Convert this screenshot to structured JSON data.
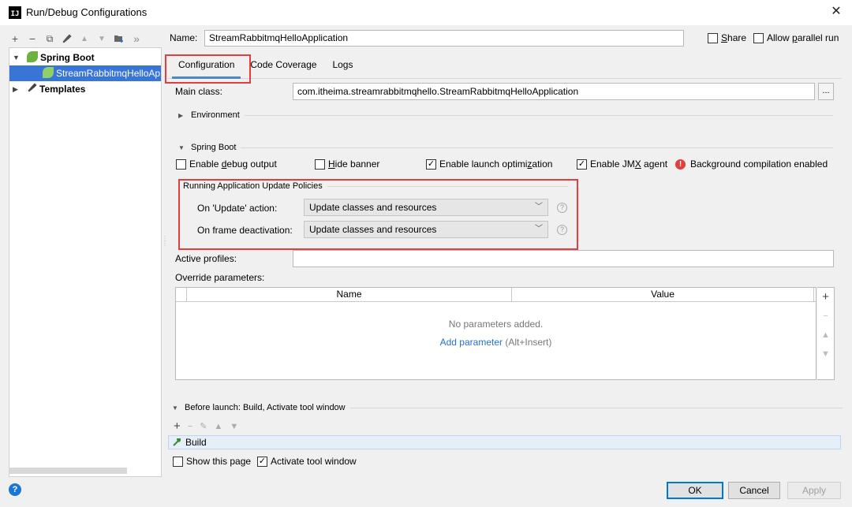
{
  "window": {
    "title": "Run/Debug Configurations",
    "app_icon_text": "IJ",
    "close_glyph": "✕"
  },
  "sidebar": {
    "toolbar": [
      {
        "icon": "plus-icon",
        "glyph": "+",
        "enabled": true
      },
      {
        "icon": "minus-icon",
        "glyph": "−",
        "enabled": true
      },
      {
        "icon": "copy-icon",
        "glyph": "⧉",
        "enabled": true
      },
      {
        "icon": "wrench-icon",
        "glyph": "🔧",
        "enabled": true
      },
      {
        "icon": "arrow-up-icon",
        "glyph": "▲",
        "enabled": false
      },
      {
        "icon": "arrow-down-icon",
        "glyph": "▼",
        "enabled": false
      },
      {
        "icon": "folder-icon",
        "glyph": "📁",
        "enabled": true
      },
      {
        "icon": "more-icon",
        "glyph": "»",
        "enabled": true
      }
    ],
    "tree": {
      "spring_boot": "Spring Boot",
      "selected_item": "StreamRabbitmqHelloAp",
      "templates": "Templates"
    }
  },
  "header": {
    "name_label": "Name:",
    "name_value": "StreamRabbitmqHelloApplication",
    "share_label": "Share",
    "share_checked": false,
    "allow_parallel_label": "Allow parallel run",
    "allow_parallel_checked": false
  },
  "tabs": [
    "Configuration",
    "Code Coverage",
    "Logs"
  ],
  "configuration": {
    "main_class_label": "Main class:",
    "main_class_value": "com.itheima.streamrabbitmqhello.StreamRabbitmqHelloApplication",
    "browse_label": "...",
    "environment_label": "Environment",
    "spring_boot_label": "Spring Boot",
    "checkboxes": {
      "debug_output": {
        "label": "Enable debug output",
        "checked": false
      },
      "hide_banner": {
        "label": "Hide banner",
        "checked": false
      },
      "launch_optimization": {
        "label": "Enable launch optimization",
        "checked": true
      },
      "jmx_agent": {
        "label": "Enable JMX agent",
        "checked": true
      }
    },
    "background_compilation": "Background compilation enabled",
    "policies": {
      "title": "Running Application Update Policies",
      "on_update_label": "On 'Update' action:",
      "on_update_value": "Update classes and resources",
      "on_frame_label": "On frame deactivation:",
      "on_frame_value": "Update classes and resources",
      "help_glyph": "?"
    },
    "active_profiles_label": "Active profiles:",
    "active_profiles_value": "",
    "override_label": "Override parameters:",
    "params_table": {
      "columns": [
        "Name",
        "Value"
      ],
      "empty_text": "No parameters added.",
      "add_link": "Add parameter",
      "add_shortcut": "(Alt+Insert)"
    }
  },
  "before_launch": {
    "title": "Before launch: Build, Activate tool window",
    "tasks": [
      "Build"
    ],
    "show_page_label": "Show this page",
    "show_page_checked": false,
    "activate_label": "Activate tool window",
    "activate_checked": true
  },
  "footer": {
    "ok": "OK",
    "cancel": "Cancel",
    "apply": "Apply",
    "help_glyph": "?"
  },
  "colors": {
    "selection": "#3875d7",
    "highlight_border": "#e53d3d",
    "link": "#2a6fc9",
    "spring_green": "#6cb33e"
  }
}
